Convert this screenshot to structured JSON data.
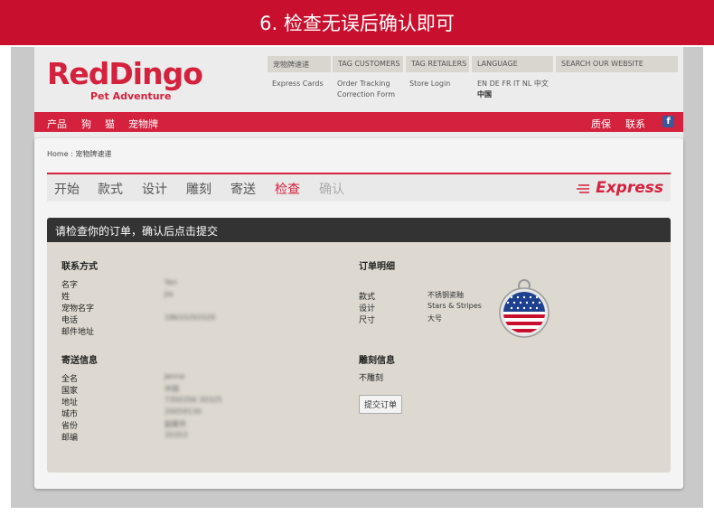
{
  "banner": {
    "title": "6. 检查无误后确认即可"
  },
  "site": {
    "logo": {
      "main": "RedDingo",
      "sub": "Pet Adventure"
    },
    "top_tabs": [
      "宠物牌速递",
      "TAG CUSTOMERS",
      "TAG RETAILERS",
      "LANGUAGE",
      "SEARCH OUR WEBSITE"
    ],
    "sublinks": {
      "express_cards": "Express Cards",
      "order_tracking": "Order Tracking",
      "correction_form": "Correction Form",
      "store_login": "Store Login",
      "languages": "EN DE FR IT NL 中文",
      "current_language": "中国"
    },
    "nav_left": [
      "产品",
      "狗",
      "猫",
      "宠物牌"
    ],
    "nav_right": [
      "质保",
      "联系"
    ],
    "facebook": "f"
  },
  "breadcrumb": "Home : 宠物牌速递",
  "steps": [
    "开始",
    "款式",
    "设计",
    "雕刻",
    "寄送",
    "检查",
    "确认"
  ],
  "express_logo": "Express",
  "form": {
    "header": "请检查你的订单，确认后点击提交",
    "contact": {
      "title": "联系方式",
      "labels": [
        "名字",
        "姓",
        "宠物名字",
        "电话",
        "邮件地址"
      ],
      "values": [
        "Yan",
        "Jia",
        "",
        "18633293329",
        ""
      ]
    },
    "shipping": {
      "title": "寄送信息",
      "labels": [
        "全名",
        "国家",
        "地址",
        "城市",
        "省份",
        "邮编"
      ],
      "values": [
        "Jenna",
        "中国",
        "7350356 30325",
        "20059130",
        "副属市",
        "35353"
      ]
    },
    "order": {
      "title": "订单明细",
      "labels": [
        "款式",
        "设计",
        "尺寸"
      ],
      "values": [
        "不锈钢瓷釉",
        "Stars & Stripes",
        "大号"
      ]
    },
    "engraving": {
      "title": "雕刻信息",
      "value": "不雕刻"
    },
    "submit_label": "提交订单"
  },
  "colors": {
    "brand_red": "#d4213d",
    "header_dark": "#333333"
  }
}
